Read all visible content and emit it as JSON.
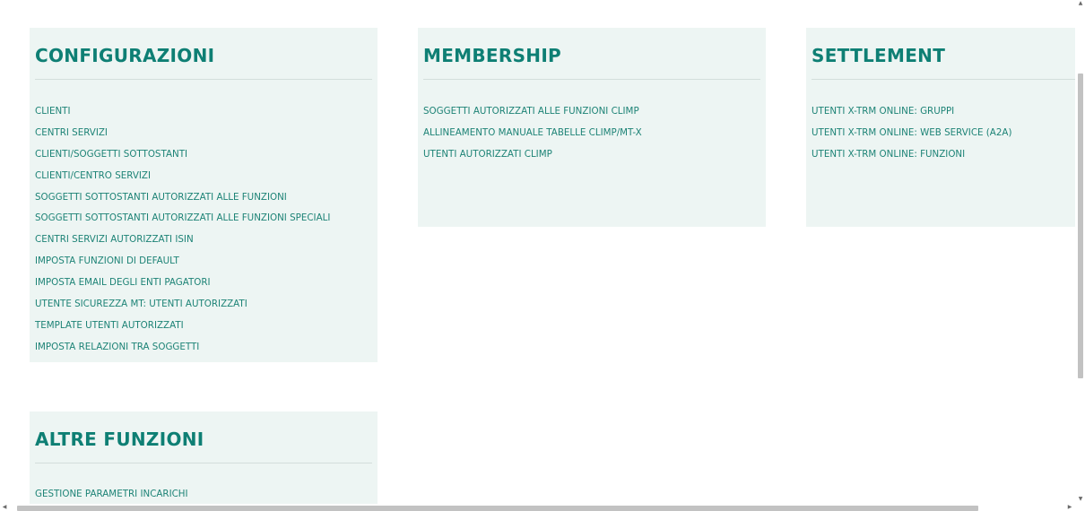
{
  "panels": {
    "configurazioni": {
      "title": "CONFIGURAZIONI",
      "items": [
        "CLIENTI",
        "CENTRI SERVIZI",
        "CLIENTI/SOGGETTI SOTTOSTANTI",
        "CLIENTI/CENTRO SERVIZI",
        "SOGGETTI SOTTOSTANTI AUTORIZZATI ALLE FUNZIONI",
        "SOGGETTI SOTTOSTANTI AUTORIZZATI ALLE FUNZIONI SPECIALI",
        "CENTRI SERVIZI AUTORIZZATI ISIN",
        "IMPOSTA FUNZIONI DI DEFAULT",
        "IMPOSTA EMAIL DEGLI ENTI PAGATORI",
        "UTENTE SICUREZZA MT: UTENTI AUTORIZZATI",
        "TEMPLATE UTENTI AUTORIZZATI",
        "IMPOSTA RELAZIONI TRA SOGGETTI"
      ]
    },
    "membership": {
      "title": "MEMBERSHIP",
      "items": [
        "SOGGETTI AUTORIZZATI ALLE FUNZIONI CLIMP",
        "ALLINEAMENTO MANUALE TABELLE CLIMP/MT-X",
        "UTENTI AUTORIZZATI CLIMP"
      ]
    },
    "settlement": {
      "title": "SETTLEMENT",
      "items": [
        "UTENTI X-TRM ONLINE: GRUPPI",
        "UTENTI X-TRM ONLINE: WEB SERVICE (A2A)",
        "UTENTI X-TRM ONLINE: FUNZIONI"
      ]
    },
    "altre_funzioni": {
      "title": "ALTRE FUNZIONI",
      "items": [
        "GESTIONE PARAMETRI INCARICHI"
      ]
    }
  },
  "scrollbars": {
    "vertical_arrow_up": "▲",
    "vertical_arrow_down": "▼",
    "horizontal_arrow_left": "◀",
    "horizontal_arrow_right": "▶"
  },
  "colors": {
    "panel_background": "#edf5f3",
    "accent": "#0e7f74",
    "link": "#1d8376"
  }
}
